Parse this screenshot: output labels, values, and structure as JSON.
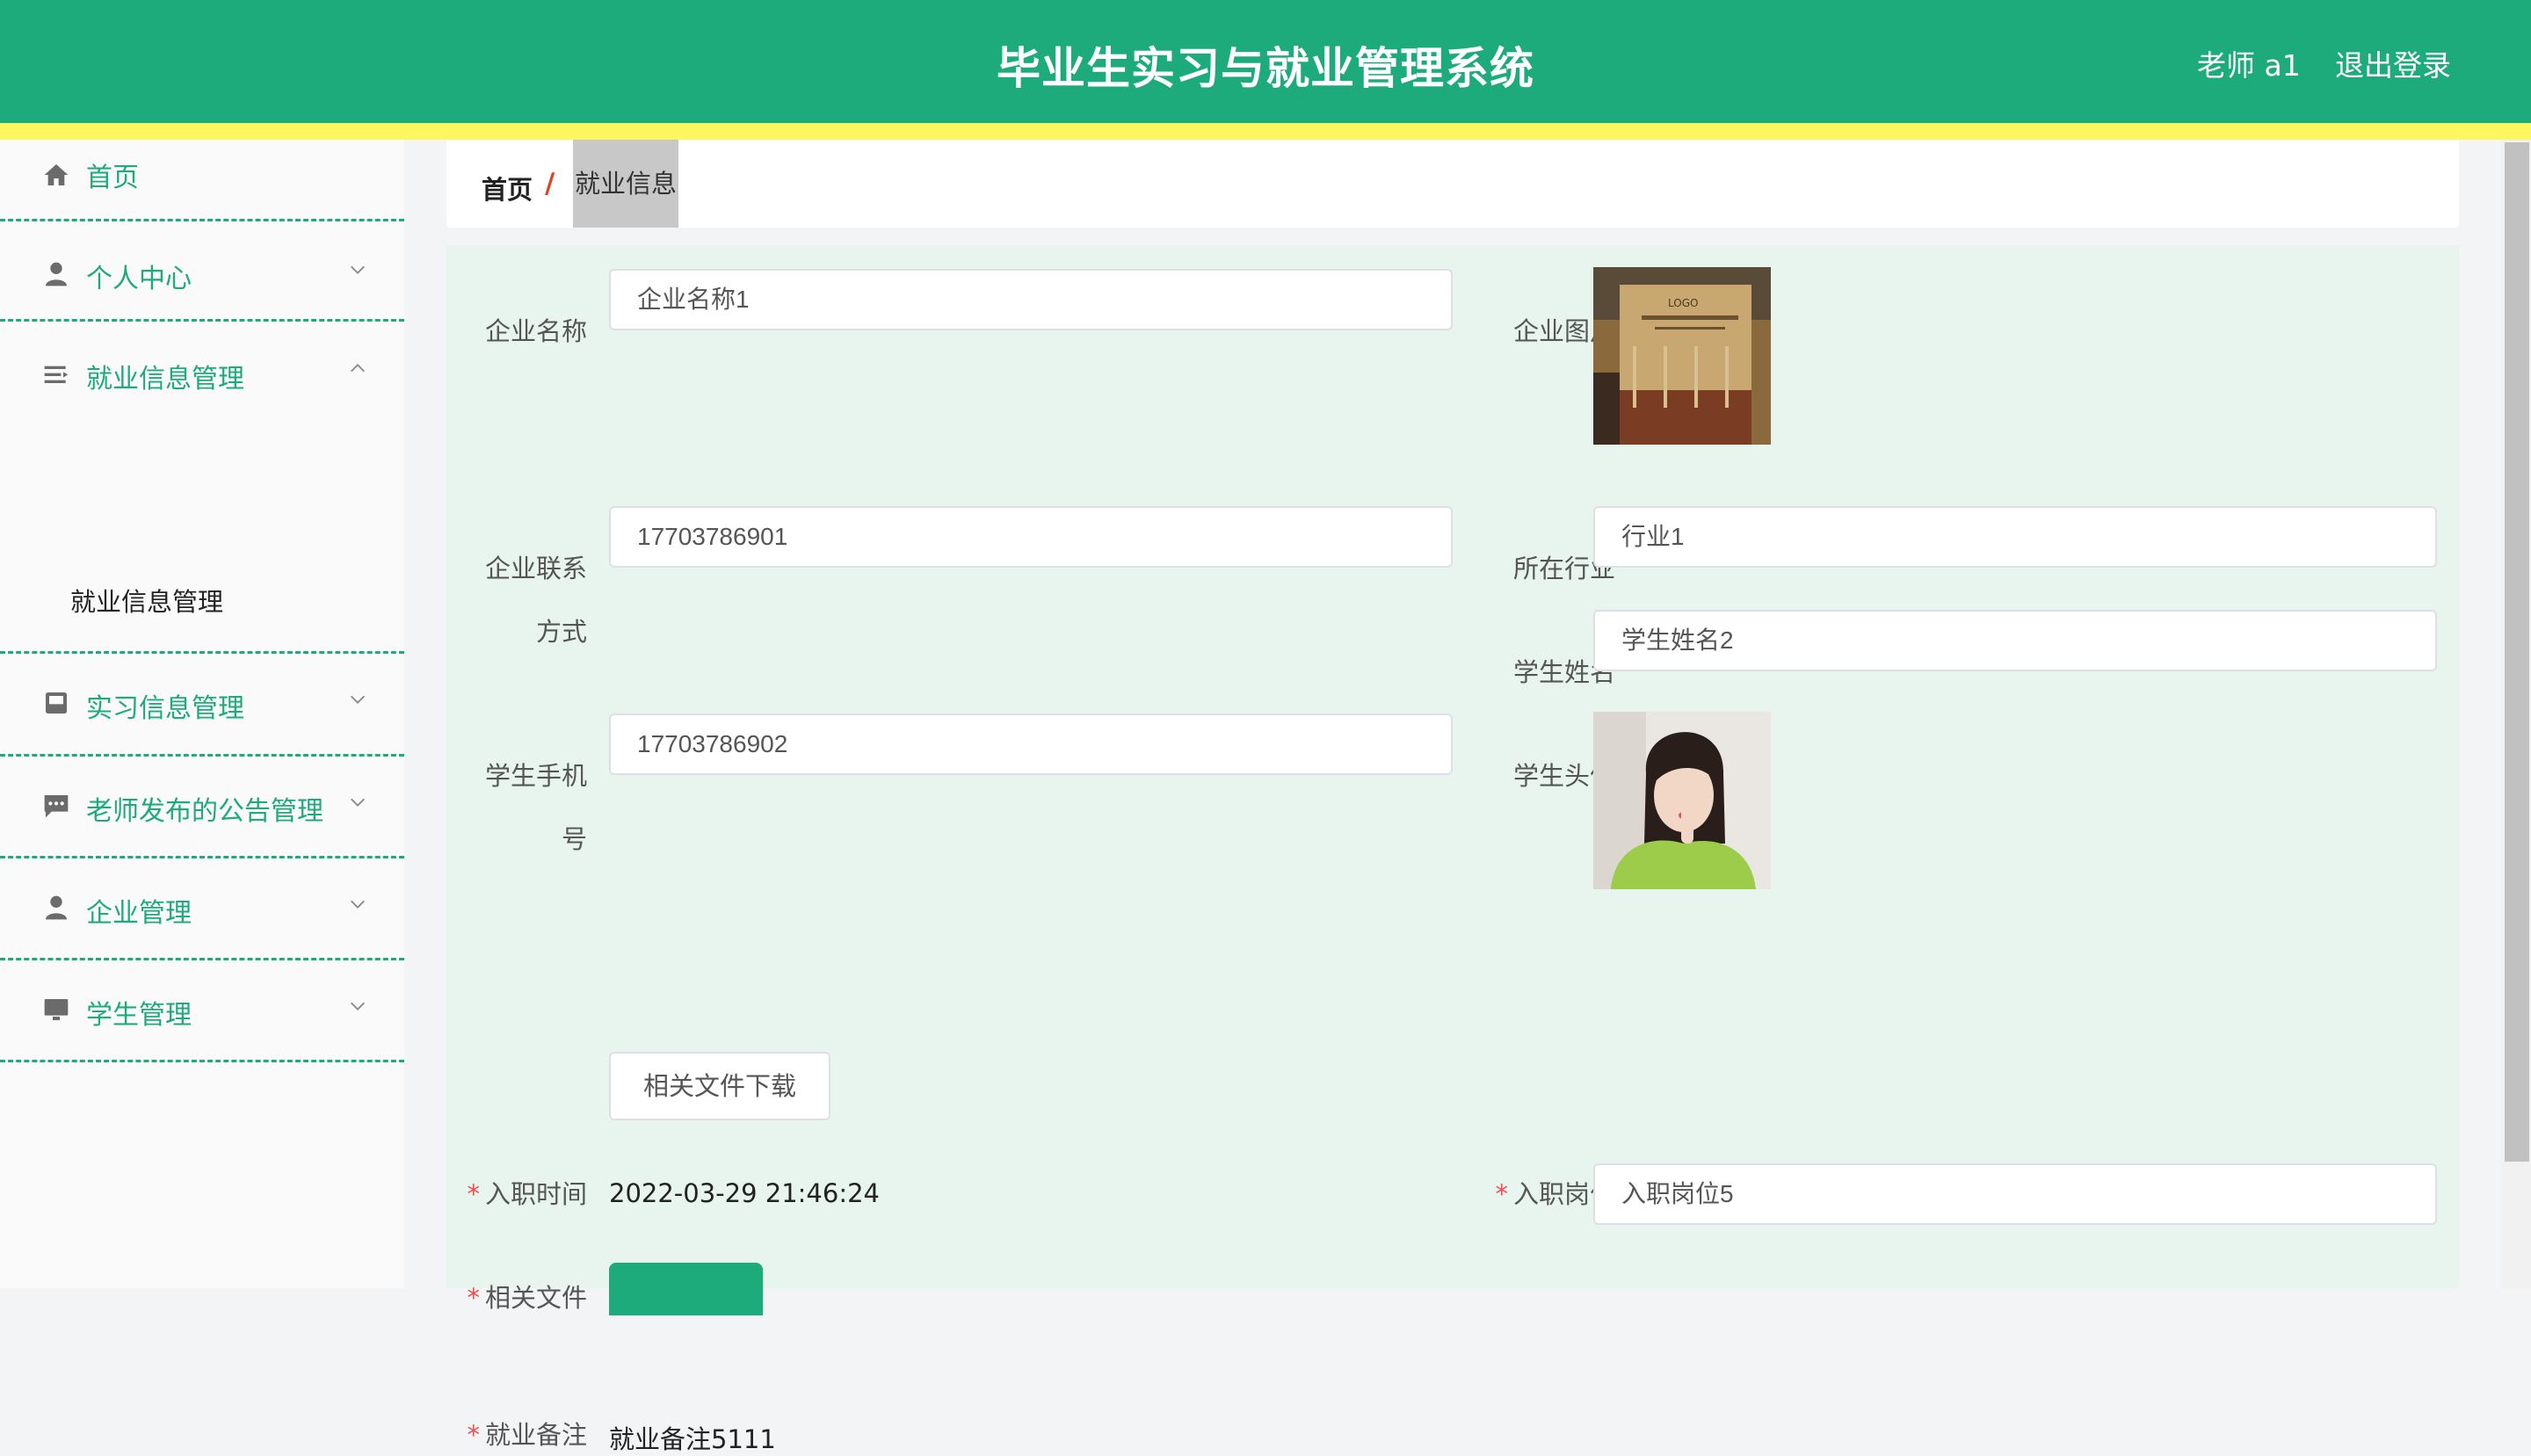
{
  "header": {
    "title": "毕业生实习与就业管理系统",
    "user": "老师 a1",
    "logout": "退出登录",
    "colors": {
      "primary": "#1eab7b",
      "accent_strip": "#fcf75f"
    }
  },
  "sidebar": {
    "items": [
      {
        "label": "首页",
        "icon": "home-icon"
      },
      {
        "label": "个人中心",
        "icon": "person-icon",
        "expanded": false
      },
      {
        "label": "就业信息管理",
        "icon": "list-icon",
        "expanded": true
      },
      {
        "label": "实习信息管理",
        "icon": "inbox-icon",
        "expanded": false
      },
      {
        "label": "老师发布的公告管理",
        "icon": "chat-icon",
        "expanded": false
      },
      {
        "label": "企业管理",
        "icon": "person-icon",
        "expanded": false
      },
      {
        "label": "学生管理",
        "icon": "monitor-icon",
        "expanded": false
      }
    ],
    "sub_item": "就业信息管理"
  },
  "breadcrumb": {
    "home": "首页",
    "separator": "/",
    "current": "就业信息"
  },
  "form": {
    "company_name": {
      "label": "企业名称",
      "value": "企业名称1"
    },
    "company_image": {
      "label": "企业图片"
    },
    "company_contact": {
      "label_line1": "企业联系",
      "label_line2": "方式",
      "value": "17703786901"
    },
    "industry": {
      "label": "所在行业",
      "value": "行业1"
    },
    "student_name": {
      "label": "学生姓名",
      "value": "学生姓名2"
    },
    "student_phone": {
      "label_line1": "学生手机",
      "label_line2": "号",
      "value": "17703786902"
    },
    "student_avatar": {
      "label": "学生头像"
    },
    "hire_time": {
      "label": "入职时间",
      "value": "2022-03-29 21:46:24"
    },
    "position": {
      "label": "入职岗位",
      "value": "入职岗位5"
    },
    "files": {
      "label": "相关文件",
      "button": "相关文件下载"
    },
    "remark": {
      "label": "就业备注",
      "value": "就业备注5111"
    },
    "required_mark": "*"
  },
  "company_logo_text": "LOGO"
}
